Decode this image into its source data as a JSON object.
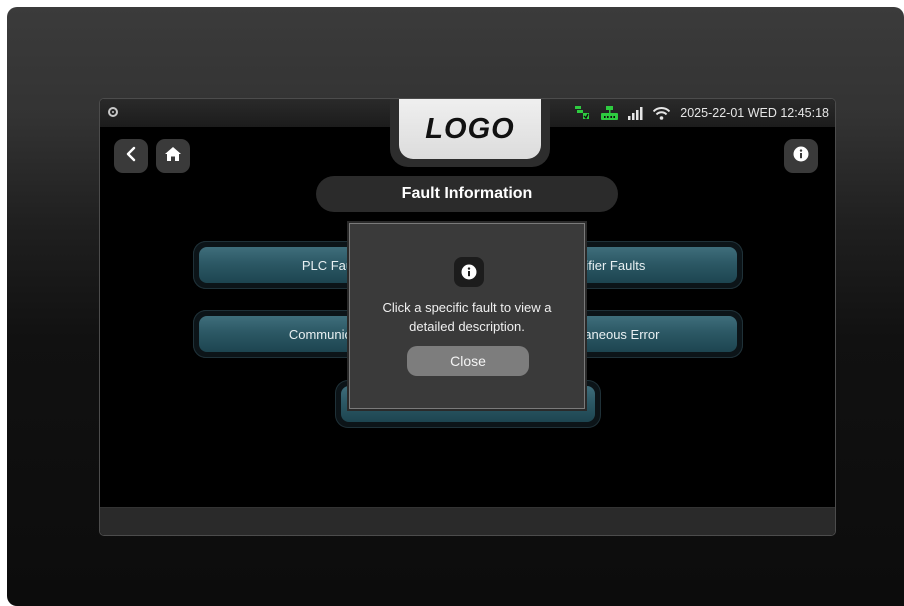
{
  "logo": {
    "text": "LOGO"
  },
  "status": {
    "datetime": "2025-22-01 WED 12:45:18",
    "icons": [
      "process-status-icon",
      "network-icon",
      "signal-bars-icon",
      "wifi-icon"
    ],
    "accent_green": "#2ecc40"
  },
  "nav": {
    "icons": [
      "back-icon",
      "home-icon",
      "info-icon"
    ]
  },
  "page": {
    "title": "Fault Information"
  },
  "faults": {
    "plc": "PLC Faults",
    "rectifier": "Rectifier Faults",
    "communication": "Communication",
    "miscellaneous": "Miscellaneous Error",
    "bottom": ""
  },
  "dialog": {
    "icon": "info-icon",
    "message": "Click a specific fault to view a detailed description.",
    "close_label": "Close"
  },
  "colors": {
    "button_teal": "#2c5865",
    "dialog_bg": "#3a3a3a",
    "close_button": "#7d7d7d"
  }
}
